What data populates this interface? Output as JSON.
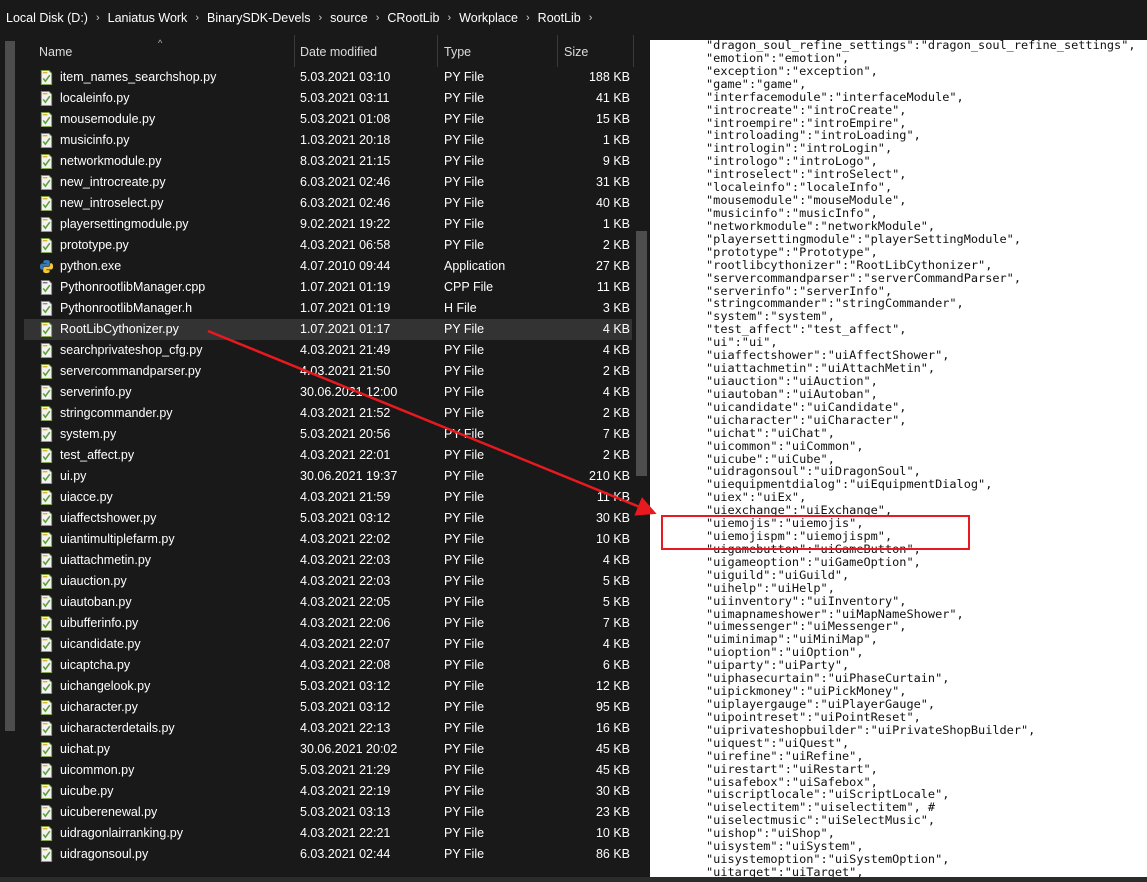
{
  "breadcrumb": [
    "Local Disk (D:)",
    "Laniatus Work",
    "BinarySDK-Devels",
    "source",
    "CRootLib",
    "Workplace",
    "RootLib"
  ],
  "breadcrumb_separator": "›",
  "columns": {
    "name": "Name",
    "date": "Date modified",
    "type": "Type",
    "size": "Size"
  },
  "files": [
    {
      "name": "item_names_searchshop.py",
      "date": "5.03.2021 03:10",
      "type": "PY File",
      "size": "188 KB",
      "icon": "python-file-icon"
    },
    {
      "name": "localeinfo.py",
      "date": "5.03.2021 03:11",
      "type": "PY File",
      "size": "41 KB",
      "icon": "python-file-icon"
    },
    {
      "name": "mousemodule.py",
      "date": "5.03.2021 01:08",
      "type": "PY File",
      "size": "15 KB",
      "icon": "python-file-icon"
    },
    {
      "name": "musicinfo.py",
      "date": "1.03.2021 20:18",
      "type": "PY File",
      "size": "1 KB",
      "icon": "python-file-icon"
    },
    {
      "name": "networkmodule.py",
      "date": "8.03.2021 21:15",
      "type": "PY File",
      "size": "9 KB",
      "icon": "python-file-icon"
    },
    {
      "name": "new_introcreate.py",
      "date": "6.03.2021 02:46",
      "type": "PY File",
      "size": "31 KB",
      "icon": "python-file-icon"
    },
    {
      "name": "new_introselect.py",
      "date": "6.03.2021 02:46",
      "type": "PY File",
      "size": "40 KB",
      "icon": "python-file-icon"
    },
    {
      "name": "playersettingmodule.py",
      "date": "9.02.2021 19:22",
      "type": "PY File",
      "size": "1 KB",
      "icon": "python-file-icon"
    },
    {
      "name": "prototype.py",
      "date": "4.03.2021 06:58",
      "type": "PY File",
      "size": "2 KB",
      "icon": "python-file-icon"
    },
    {
      "name": "python.exe",
      "date": "4.07.2010 09:44",
      "type": "Application",
      "size": "27 KB",
      "icon": "python-exe-icon"
    },
    {
      "name": "PythonrootlibManager.cpp",
      "date": "1.07.2021 01:19",
      "type": "CPP File",
      "size": "11 KB",
      "icon": "cpp-file-icon"
    },
    {
      "name": "PythonrootlibManager.h",
      "date": "1.07.2021 01:19",
      "type": "H File",
      "size": "3 KB",
      "icon": "header-file-icon"
    },
    {
      "name": "RootLibCythonizer.py",
      "date": "1.07.2021 01:17",
      "type": "PY File",
      "size": "4 KB",
      "icon": "python-file-icon"
    },
    {
      "name": "searchprivateshop_cfg.py",
      "date": "4.03.2021 21:49",
      "type": "PY File",
      "size": "4 KB",
      "icon": "python-file-icon"
    },
    {
      "name": "servercommandparser.py",
      "date": "4.03.2021 21:50",
      "type": "PY File",
      "size": "2 KB",
      "icon": "python-file-icon"
    },
    {
      "name": "serverinfo.py",
      "date": "30.06.2021 12:00",
      "type": "PY File",
      "size": "4 KB",
      "icon": "python-file-icon"
    },
    {
      "name": "stringcommander.py",
      "date": "4.03.2021 21:52",
      "type": "PY File",
      "size": "2 KB",
      "icon": "python-file-icon"
    },
    {
      "name": "system.py",
      "date": "5.03.2021 20:56",
      "type": "PY File",
      "size": "7 KB",
      "icon": "python-file-icon"
    },
    {
      "name": "test_affect.py",
      "date": "4.03.2021 22:01",
      "type": "PY File",
      "size": "2 KB",
      "icon": "python-file-icon"
    },
    {
      "name": "ui.py",
      "date": "30.06.2021 19:37",
      "type": "PY File",
      "size": "210 KB",
      "icon": "python-file-icon"
    },
    {
      "name": "uiacce.py",
      "date": "4.03.2021 21:59",
      "type": "PY File",
      "size": "11 KB",
      "icon": "python-file-icon"
    },
    {
      "name": "uiaffectshower.py",
      "date": "5.03.2021 03:12",
      "type": "PY File",
      "size": "30 KB",
      "icon": "python-file-icon"
    },
    {
      "name": "uiantimultiplefarm.py",
      "date": "4.03.2021 22:02",
      "type": "PY File",
      "size": "10 KB",
      "icon": "python-file-icon"
    },
    {
      "name": "uiattachmetin.py",
      "date": "4.03.2021 22:03",
      "type": "PY File",
      "size": "4 KB",
      "icon": "python-file-icon"
    },
    {
      "name": "uiauction.py",
      "date": "4.03.2021 22:03",
      "type": "PY File",
      "size": "5 KB",
      "icon": "python-file-icon"
    },
    {
      "name": "uiautoban.py",
      "date": "4.03.2021 22:05",
      "type": "PY File",
      "size": "5 KB",
      "icon": "python-file-icon"
    },
    {
      "name": "uibufferinfo.py",
      "date": "4.03.2021 22:06",
      "type": "PY File",
      "size": "7 KB",
      "icon": "python-file-icon"
    },
    {
      "name": "uicandidate.py",
      "date": "4.03.2021 22:07",
      "type": "PY File",
      "size": "4 KB",
      "icon": "python-file-icon"
    },
    {
      "name": "uicaptcha.py",
      "date": "4.03.2021 22:08",
      "type": "PY File",
      "size": "6 KB",
      "icon": "python-file-icon"
    },
    {
      "name": "uichangelook.py",
      "date": "5.03.2021 03:12",
      "type": "PY File",
      "size": "12 KB",
      "icon": "python-file-icon"
    },
    {
      "name": "uicharacter.py",
      "date": "5.03.2021 03:12",
      "type": "PY File",
      "size": "95 KB",
      "icon": "python-file-icon"
    },
    {
      "name": "uicharacterdetails.py",
      "date": "4.03.2021 22:13",
      "type": "PY File",
      "size": "16 KB",
      "icon": "python-file-icon"
    },
    {
      "name": "uichat.py",
      "date": "30.06.2021 20:02",
      "type": "PY File",
      "size": "45 KB",
      "icon": "python-file-icon"
    },
    {
      "name": "uicommon.py",
      "date": "5.03.2021 21:29",
      "type": "PY File",
      "size": "45 KB",
      "icon": "python-file-icon"
    },
    {
      "name": "uicube.py",
      "date": "4.03.2021 22:19",
      "type": "PY File",
      "size": "30 KB",
      "icon": "python-file-icon"
    },
    {
      "name": "uicuberenewal.py",
      "date": "5.03.2021 03:13",
      "type": "PY File",
      "size": "23 KB",
      "icon": "python-file-icon"
    },
    {
      "name": "uidragonlairranking.py",
      "date": "4.03.2021 22:21",
      "type": "PY File",
      "size": "10 KB",
      "icon": "python-file-icon"
    },
    {
      "name": "uidragonsoul.py",
      "date": "6.03.2021 02:44",
      "type": "PY File",
      "size": "86 KB",
      "icon": "python-file-icon"
    }
  ],
  "code_lines": [
    "\"dragon_soul_refine_settings\":\"dragon_soul_refine_settings\",",
    "\"emotion\":\"emotion\",",
    "\"exception\":\"exception\",",
    "\"game\":\"game\",",
    "\"interfacemodule\":\"interfaceModule\",",
    "\"introcreate\":\"introCreate\",",
    "\"introempire\":\"introEmpire\",",
    "\"introloading\":\"introLoading\",",
    "\"intrologin\":\"introLogin\",",
    "\"intrologo\":\"introLogo\",",
    "\"introselect\":\"introSelect\",",
    "\"localeinfo\":\"localeInfo\",",
    "\"mousemodule\":\"mouseModule\",",
    "\"musicinfo\":\"musicInfo\",",
    "\"networkmodule\":\"networkModule\",",
    "\"playersettingmodule\":\"playerSettingModule\",",
    "\"prototype\":\"Prototype\",",
    "\"rootlibcythonizer\":\"RootLibCythonizer\",",
    "\"servercommandparser\":\"serverCommandParser\",",
    "\"serverinfo\":\"serverInfo\",",
    "\"stringcommander\":\"stringCommander\",",
    "\"system\":\"system\",",
    "\"test_affect\":\"test_affect\",",
    "\"ui\":\"ui\",",
    "\"uiaffectshower\":\"uiAffectShower\",",
    "\"uiattachmetin\":\"uiAttachMetin\",",
    "\"uiauction\":\"uiAuction\",",
    "\"uiautoban\":\"uiAutoban\",",
    "\"uicandidate\":\"uiCandidate\",",
    "\"uicharacter\":\"uiCharacter\",",
    "\"uichat\":\"uiChat\",",
    "\"uicommon\":\"uiCommon\",",
    "\"uicube\":\"uiCube\",",
    "\"uidragonsoul\":\"uiDragonSoul\",",
    "\"uiequipmentdialog\":\"uiEquipmentDialog\",",
    "\"uiex\":\"uiEx\",",
    "\"uiexchange\":\"uiExchange\",",
    "\"uiemojis\":\"uiemojis\",",
    "\"uiemojispm\":\"uiemojispm\",",
    "\"uigamebutton\":\"uiGameButton\",",
    "\"uigameoption\":\"uiGameOption\",",
    "\"uiguild\":\"uiGuild\",",
    "\"uihelp\":\"uiHelp\",",
    "\"uiinventory\":\"uiInventory\",",
    "\"uimapnameshower\":\"uiMapNameShower\",",
    "\"uimessenger\":\"uiMessenger\",",
    "\"uiminimap\":\"uiMiniMap\",",
    "\"uioption\":\"uiOption\",",
    "\"uiparty\":\"uiParty\",",
    "\"uiphasecurtain\":\"uiPhaseCurtain\",",
    "\"uipickmoney\":\"uiPickMoney\",",
    "\"uiplayergauge\":\"uiPlayerGauge\",",
    "\"uipointreset\":\"uiPointReset\",",
    "\"uiprivateshopbuilder\":\"uiPrivateShopBuilder\",",
    "\"uiquest\":\"uiQuest\",",
    "\"uirefine\":\"uiRefine\",",
    "\"uirestart\":\"uiRestart\",",
    "\"uisafebox\":\"uiSafebox\",",
    "\"uiscriptlocale\":\"uiScriptLocale\",",
    "\"uiselectitem\":\"uiselectitem\", #",
    "\"uiselectmusic\":\"uiSelectMusic\",",
    "\"uishop\":\"uiShop\",",
    "\"uisystem\":\"uiSystem\",",
    "\"uisystemoption\":\"uiSystemOption\",",
    "\"uitarget\":\"uiTarget\","
  ],
  "colors": {
    "background": "#191919",
    "selected_row": "#333333",
    "annotation": "#e8191f",
    "editor_background": "#ffffff"
  }
}
